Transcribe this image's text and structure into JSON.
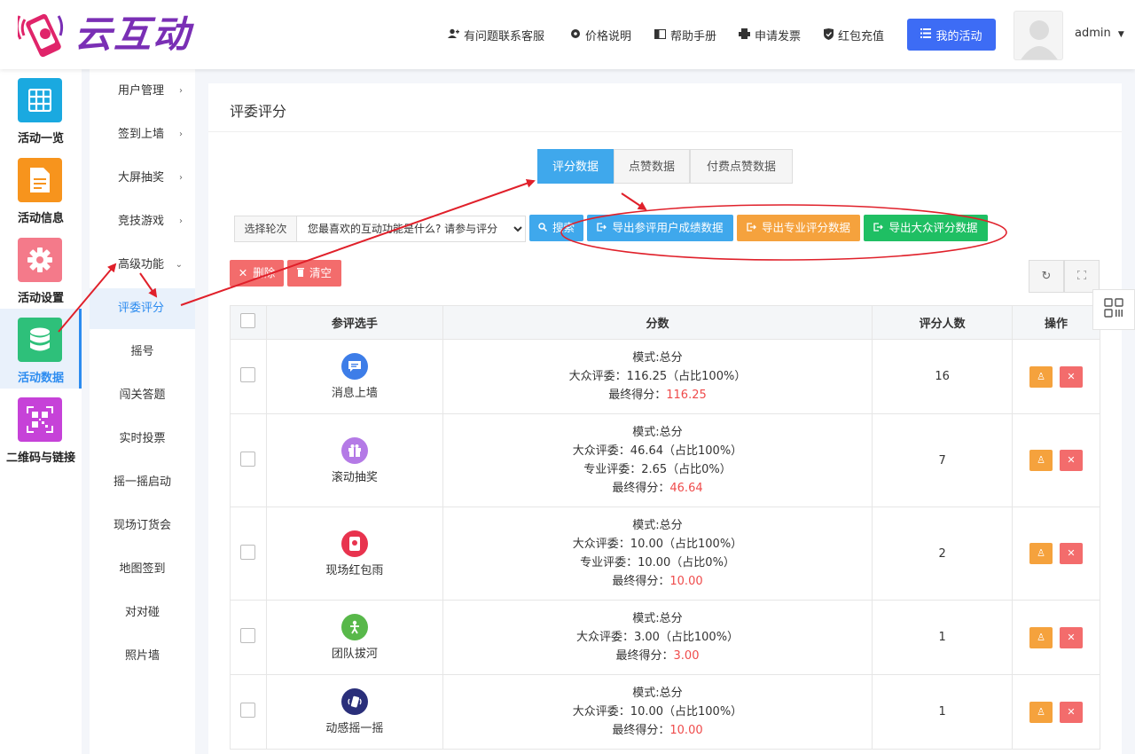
{
  "brand": {
    "name": "云互动"
  },
  "header": {
    "links": [
      {
        "icon": "user-plus-icon",
        "label": "有问题联系客服"
      },
      {
        "icon": "gear-icon",
        "label": "价格说明"
      },
      {
        "icon": "book-icon",
        "label": "帮助手册"
      },
      {
        "icon": "printer-icon",
        "label": "申请发票"
      },
      {
        "icon": "shield-check-icon",
        "label": "红包充值"
      }
    ],
    "primary_button": "我的活动",
    "user": "admin"
  },
  "left_nav": [
    {
      "label": "活动一览",
      "icon": "grid-icon",
      "color": "#1aa9e0"
    },
    {
      "label": "活动信息",
      "icon": "document-icon",
      "color": "#f7941d"
    },
    {
      "label": "活动设置",
      "icon": "gear-icon",
      "color": "#f47a8a"
    },
    {
      "label": "活动数据",
      "icon": "database-icon",
      "color": "#2ec07a",
      "active": true
    },
    {
      "label": "二维码与链接",
      "icon": "qrcode-icon",
      "color": "#c642d8"
    }
  ],
  "sub_nav": [
    {
      "label": "用户管理",
      "arrow": "›"
    },
    {
      "label": "签到上墙",
      "arrow": "›"
    },
    {
      "label": "大屏抽奖",
      "arrow": "›"
    },
    {
      "label": "竞技游戏",
      "arrow": "›"
    },
    {
      "label": "高级功能",
      "arrow": "⌄"
    },
    {
      "label": "评委评分",
      "active": true
    },
    {
      "label": "摇号"
    },
    {
      "label": "闯关答题"
    },
    {
      "label": "实时投票"
    },
    {
      "label": "摇一摇启动"
    },
    {
      "label": "现场订货会"
    },
    {
      "label": "地图签到"
    },
    {
      "label": "对对碰"
    },
    {
      "label": "照片墙"
    }
  ],
  "main": {
    "title": "评委评分",
    "tabs": [
      "评分数据",
      "点赞数据",
      "付费点赞数据"
    ],
    "filter": {
      "label": "选择轮次",
      "selected": "您最喜欢的互动功能是什么? 请参与评分"
    },
    "buttons": {
      "search": "搜索",
      "export_participants": "导出参评用户成绩数据",
      "export_professional": "导出专业评分数据",
      "export_public": "导出大众评分数据",
      "delete": "删除",
      "clear": "清空"
    },
    "table": {
      "headers": [
        "参评选手",
        "分数",
        "评分人数",
        "操作"
      ],
      "rows": [
        {
          "name": "消息上墙",
          "icon": "message-icon",
          "color": "#3d7de8",
          "lines": [
            "模式:总分",
            "大众评委：116.25（占比100%）"
          ],
          "final_label": "最终得分：",
          "final": "116.25",
          "count": "16"
        },
        {
          "name": "滚动抽奖",
          "icon": "gift-icon",
          "color": "#b47ae6",
          "lines": [
            "模式:总分",
            "大众评委：46.64（占比100%）",
            "专业评委：2.65（占比0%）"
          ],
          "final_label": "最终得分：",
          "final": "46.64",
          "count": "7"
        },
        {
          "name": "现场红包雨",
          "icon": "red-packet-icon",
          "color": "#e8334e",
          "lines": [
            "模式:总分",
            "大众评委：10.00（占比100%）",
            "专业评委：10.00（占比0%）"
          ],
          "final_label": "最终得分：",
          "final": "10.00",
          "count": "2"
        },
        {
          "name": "团队拔河",
          "icon": "tug-of-war-icon",
          "color": "#58b84a",
          "lines": [
            "模式:总分",
            "大众评委：3.00（占比100%）"
          ],
          "final_label": "最终得分：",
          "final": "3.00",
          "count": "1"
        },
        {
          "name": "动感摇一摇",
          "icon": "shake-icon",
          "color": "#2a2f7a",
          "lines": [
            "模式:总分",
            "大众评委：10.00（占比100%）"
          ],
          "final_label": "最终得分：",
          "final": "10.00",
          "count": "1"
        }
      ]
    }
  }
}
